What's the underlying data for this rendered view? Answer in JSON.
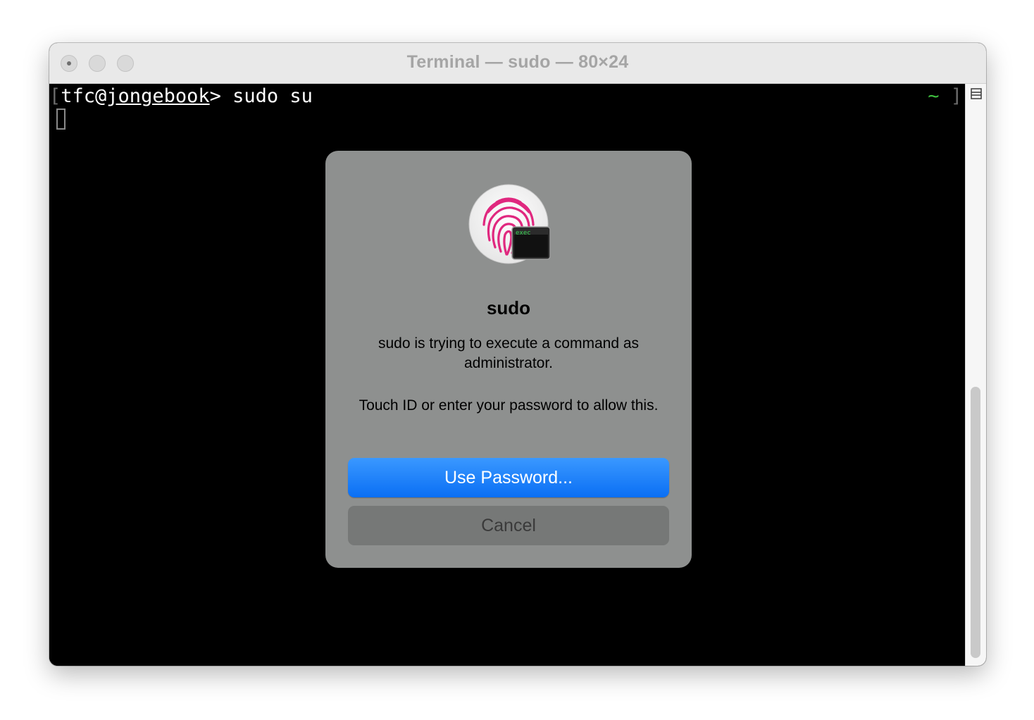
{
  "window": {
    "title": "Terminal — sudo — 80×24"
  },
  "terminal": {
    "bracket_open": "[",
    "user": "tfc@",
    "host": "jongebook",
    "prompt_char": ">",
    "command": " sudo su",
    "rprompt_dir": "~",
    "bracket_close": "]"
  },
  "dialog": {
    "badge_text": "exec",
    "title": "sudo",
    "message": "sudo is trying to execute a command as administrator.",
    "instructions": "Touch ID or enter your password to allow this.",
    "primary_button": "Use Password...",
    "secondary_button": "Cancel"
  },
  "colors": {
    "accent_blue": "#0a6ff4",
    "fingerprint": "#e0287f",
    "prompt_tilde": "#3fbf3f"
  },
  "icons": [
    "fingerprint-icon",
    "terminal-exec-icon",
    "split-pane-icon"
  ]
}
